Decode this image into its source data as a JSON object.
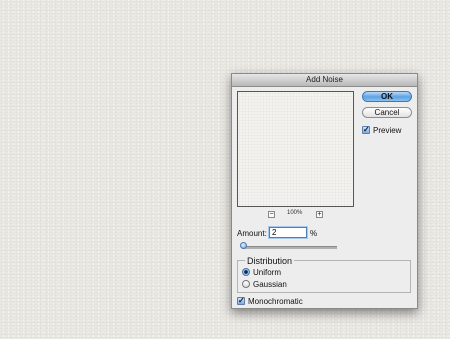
{
  "dialog": {
    "title": "Add Noise",
    "ok_label": "OK",
    "cancel_label": "Cancel",
    "preview": {
      "label": "Preview",
      "checked": true
    },
    "zoom": {
      "minus": "−",
      "level": "100%",
      "plus": "+"
    },
    "amount": {
      "label": "Amount:",
      "value": "2",
      "unit": "%"
    },
    "distribution": {
      "title": "Distribution",
      "options": [
        {
          "label": "Uniform",
          "selected": true
        },
        {
          "label": "Gaussian",
          "selected": false
        }
      ]
    },
    "monochromatic": {
      "label": "Monochromatic",
      "checked": true
    },
    "check_glyph": "✓"
  }
}
